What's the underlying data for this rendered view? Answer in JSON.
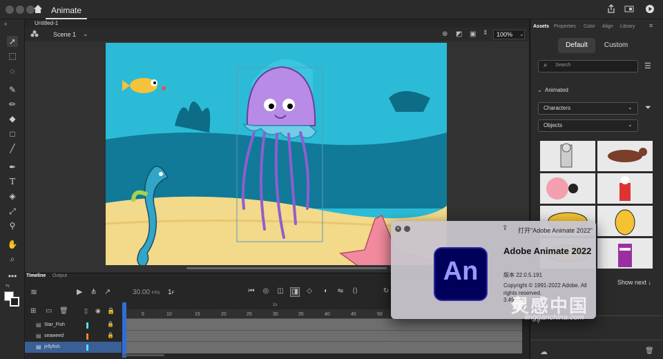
{
  "app": {
    "tab": "Animate"
  },
  "document": {
    "tab": "Untitled-1",
    "scene": "Scene 1",
    "zoom": "100%"
  },
  "timeline": {
    "tabs": [
      "Timeline",
      "Output"
    ],
    "fps": "30.00",
    "fps_unit": "FPS",
    "current_frame": "1",
    "frame_unit": "F",
    "ruler_marks": [
      "5",
      "10",
      "15",
      "20",
      "25",
      "30",
      "35",
      "40",
      "45",
      "50"
    ],
    "ruler_seconds": "1s",
    "layers": [
      {
        "name": "Star_Fish",
        "color": "#4fe3f0"
      },
      {
        "name": "seaweed",
        "color": "#f08a2a"
      },
      {
        "name": "jellyfish",
        "color": "#4fe3f0"
      }
    ]
  },
  "right_panel": {
    "tabs": [
      "Assets",
      "Properties",
      "Color",
      "Align",
      "Library"
    ],
    "default_label": "Default",
    "custom_label": "Custom",
    "search_placeholder": "Search",
    "section": "Animated",
    "category_dd": "Characters",
    "subcategory_dd": "Objects",
    "show_next": "Show next ↓"
  },
  "dialog": {
    "title": "打开\"Adobe Animate 2022\"",
    "logo": "An",
    "product": "Adobe Animate 2022",
    "version": "版本 22.0.5.191",
    "copyright": "Copyright © 1991-2022 Adobe. All rights reserved.",
    "build": "3.49.68"
  },
  "watermark": {
    "text": "灵感中国",
    "sub": "lingganchina.com"
  },
  "colors": {
    "accent": "#2f6fd6",
    "stage_water": "#2bbbd6",
    "sand": "#f3d98a",
    "layer_selected": "#3a5f96"
  }
}
